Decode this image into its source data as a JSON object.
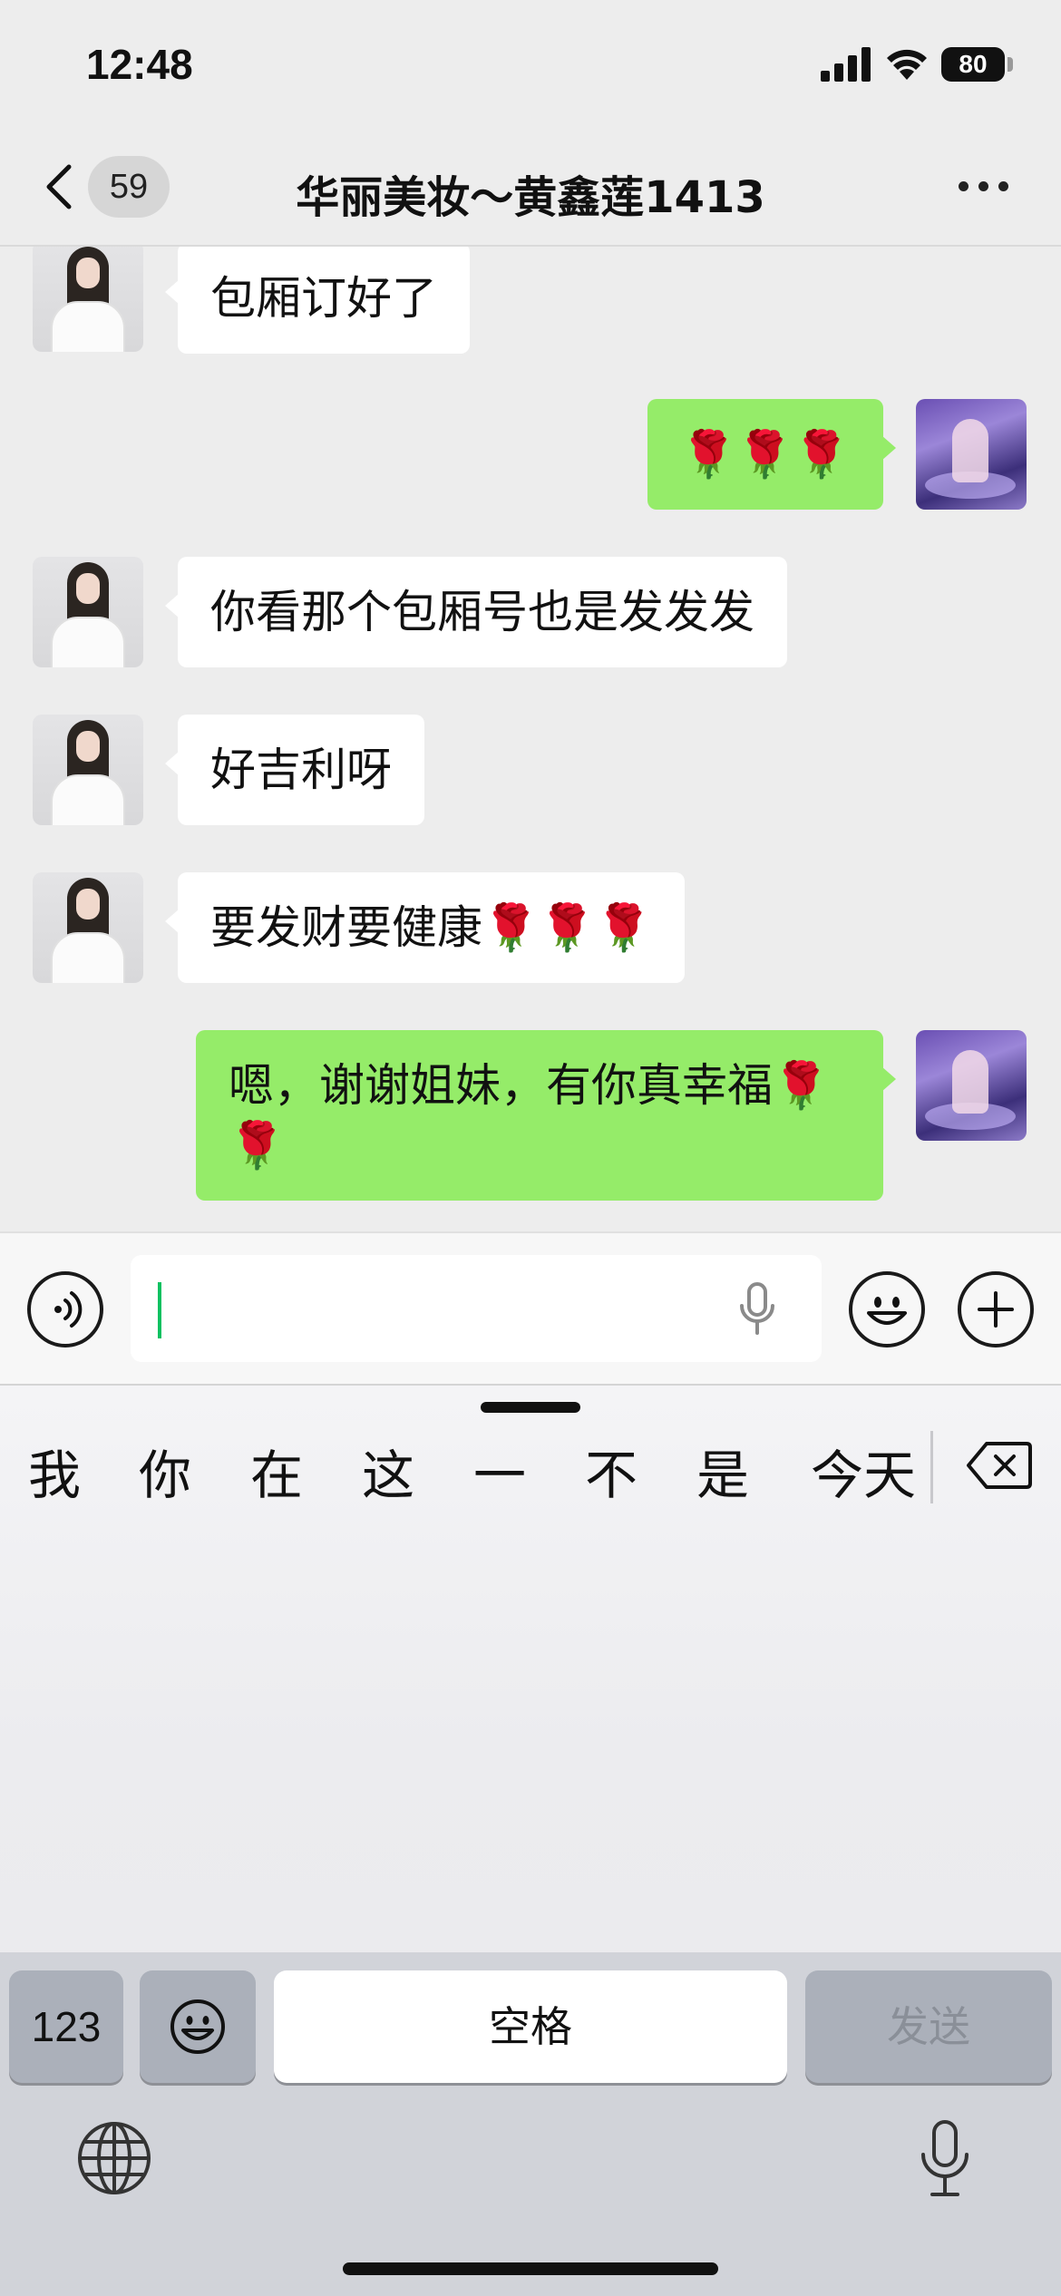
{
  "status_bar": {
    "time": "12:48",
    "battery": "80"
  },
  "nav": {
    "back_count": "59",
    "title": "华丽美妆～黄鑫莲1413"
  },
  "messages": [
    {
      "side": "left",
      "text": "包厢订好了"
    },
    {
      "side": "right",
      "text": "🌹🌹🌹"
    },
    {
      "side": "left",
      "text": "你看那个包厢号也是发发发"
    },
    {
      "side": "left",
      "text": "好吉利呀"
    },
    {
      "side": "left",
      "text": "要发财要健康🌹🌹🌹"
    },
    {
      "side": "right",
      "line1": "嗯，谢谢姐妹，有你真幸福🌹",
      "line2": "🌹"
    }
  ],
  "input": {
    "value": ""
  },
  "keyboard": {
    "candidates": [
      "我",
      "你",
      "在",
      "这",
      "一",
      "不",
      "是",
      "今天"
    ],
    "num_key": "123",
    "space_key": "空格",
    "send_key": "发送"
  },
  "colors": {
    "accent": "#07c160",
    "bubble_right": "#95ec69",
    "bubble_left": "#ffffff",
    "chat_bg": "#ededed"
  }
}
